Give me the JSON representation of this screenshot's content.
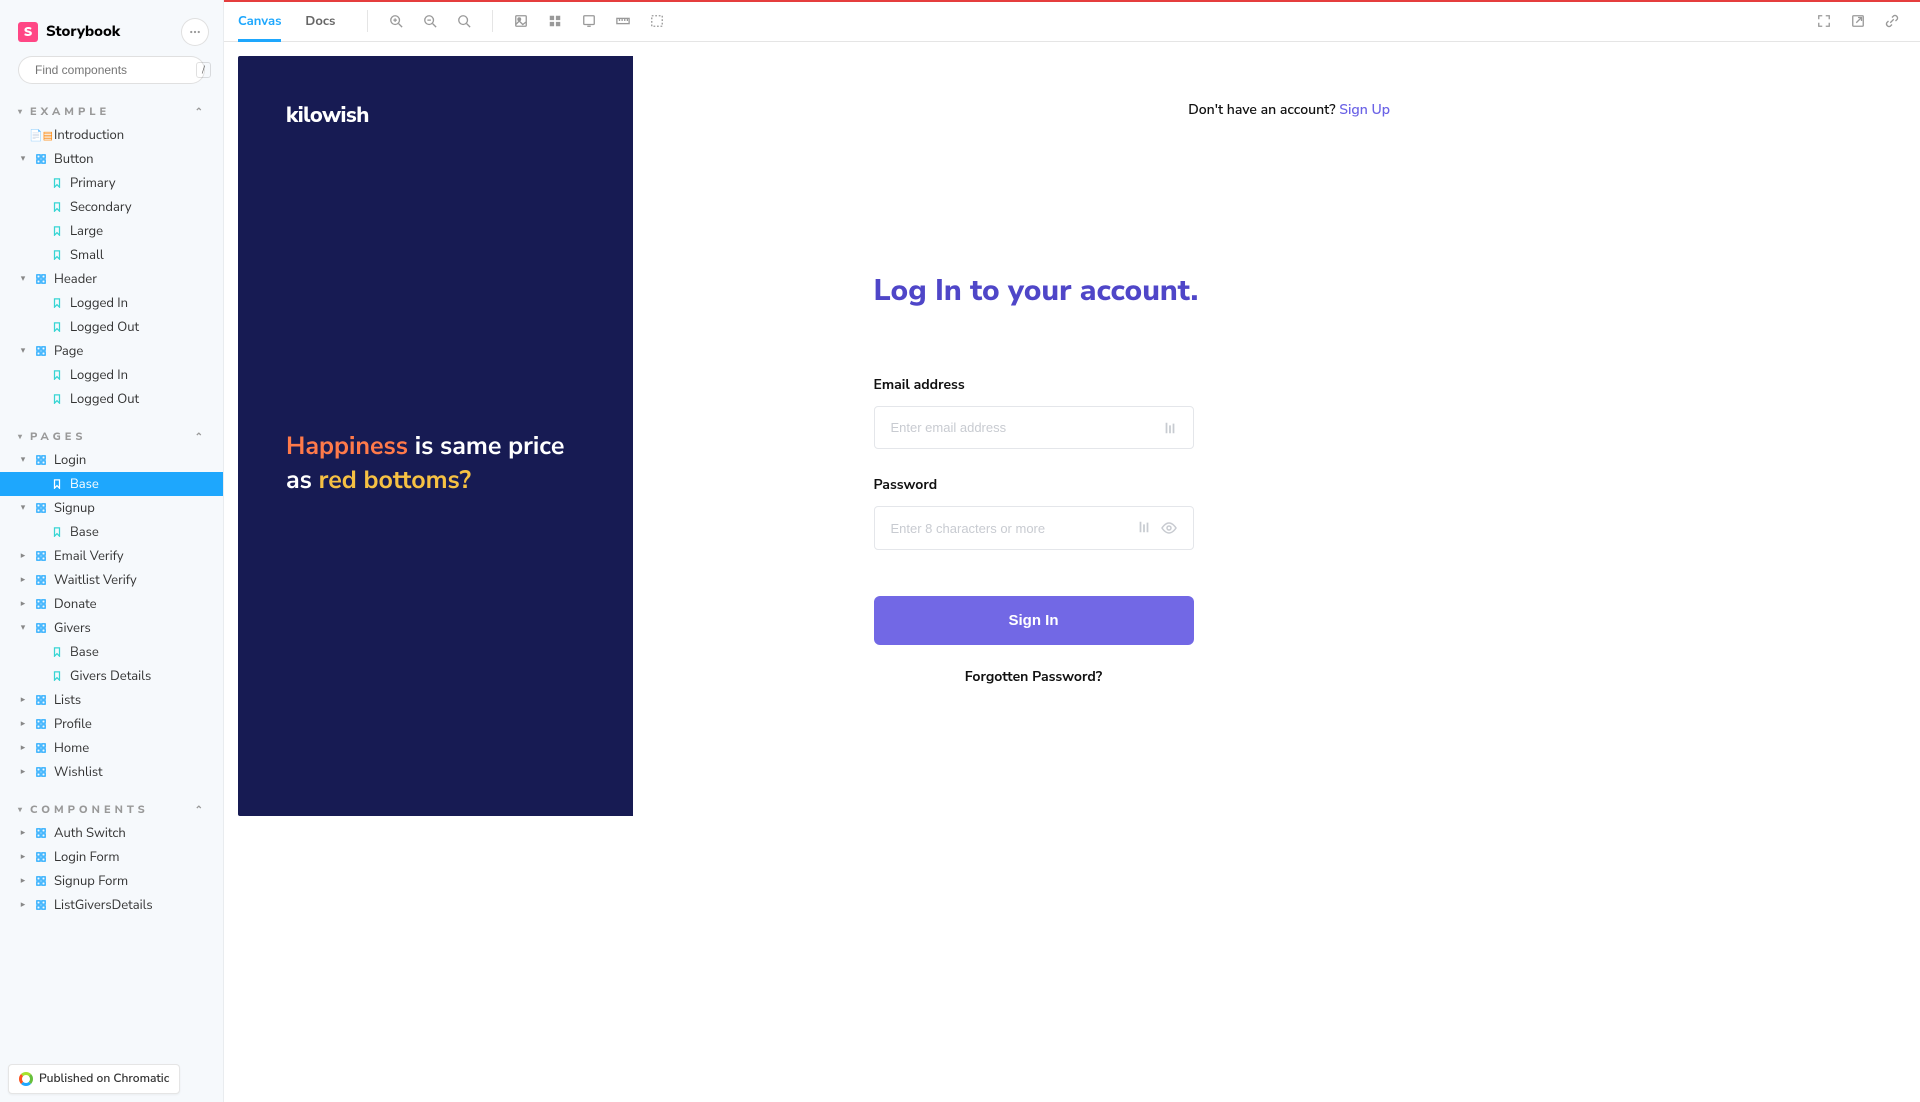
{
  "app": {
    "name": "Storybook"
  },
  "search": {
    "placeholder": "Find components",
    "shortcut": "/"
  },
  "sections": {
    "example": {
      "title": "EXAMPLE",
      "items": [
        {
          "label": "Introduction",
          "type": "doc",
          "indent": 1
        },
        {
          "label": "Button",
          "type": "component",
          "indent": 1,
          "expanded": true
        },
        {
          "label": "Primary",
          "type": "story",
          "indent": 2
        },
        {
          "label": "Secondary",
          "type": "story",
          "indent": 2
        },
        {
          "label": "Large",
          "type": "story",
          "indent": 2
        },
        {
          "label": "Small",
          "type": "story",
          "indent": 2
        },
        {
          "label": "Header",
          "type": "component",
          "indent": 1,
          "expanded": true
        },
        {
          "label": "Logged In",
          "type": "story",
          "indent": 2
        },
        {
          "label": "Logged Out",
          "type": "story",
          "indent": 2
        },
        {
          "label": "Page",
          "type": "component",
          "indent": 1,
          "expanded": true
        },
        {
          "label": "Logged In",
          "type": "story",
          "indent": 2
        },
        {
          "label": "Logged Out",
          "type": "story",
          "indent": 2
        }
      ]
    },
    "pages": {
      "title": "PAGES",
      "items": [
        {
          "label": "Login",
          "type": "component",
          "indent": 1,
          "expanded": true
        },
        {
          "label": "Base",
          "type": "story",
          "indent": 2,
          "selected": true
        },
        {
          "label": "Signup",
          "type": "component",
          "indent": 1,
          "expanded": true
        },
        {
          "label": "Base",
          "type": "story",
          "indent": 2
        },
        {
          "label": "Email Verify",
          "type": "component",
          "indent": 1
        },
        {
          "label": "Waitlist Verify",
          "type": "component",
          "indent": 1
        },
        {
          "label": "Donate",
          "type": "component",
          "indent": 1
        },
        {
          "label": "Givers",
          "type": "component",
          "indent": 1,
          "expanded": true
        },
        {
          "label": "Base",
          "type": "story",
          "indent": 2
        },
        {
          "label": "Givers Details",
          "type": "story",
          "indent": 2
        },
        {
          "label": "Lists",
          "type": "component",
          "indent": 1
        },
        {
          "label": "Profile",
          "type": "component",
          "indent": 1
        },
        {
          "label": "Home",
          "type": "component",
          "indent": 1
        },
        {
          "label": "Wishlist",
          "type": "component",
          "indent": 1
        }
      ]
    },
    "components": {
      "title": "COMPONENTS",
      "items": [
        {
          "label": "Auth Switch",
          "type": "component",
          "indent": 1
        },
        {
          "label": "Login Form",
          "type": "component",
          "indent": 1
        },
        {
          "label": "Signup Form",
          "type": "component",
          "indent": 1
        },
        {
          "label": "ListGiversDetails",
          "type": "component",
          "indent": 1
        }
      ]
    }
  },
  "published": "Published on Chromatic",
  "toolbar": {
    "tabs": [
      "Canvas",
      "Docs"
    ],
    "activeTab": 0
  },
  "login": {
    "brand": "kilowish",
    "tagline": {
      "p1": "Happiness",
      "p2": " is same price as ",
      "p3": "red bottoms?"
    },
    "top_link_text": "Don't have an account? ",
    "top_link_action": "Sign Up",
    "title": "Log In to your account.",
    "email_label": "Email address",
    "email_placeholder": "Enter email address",
    "password_label": "Password",
    "password_placeholder": "Enter 8 characters or more",
    "submit": "Sign In",
    "forgot": "Forgotten Password?"
  }
}
